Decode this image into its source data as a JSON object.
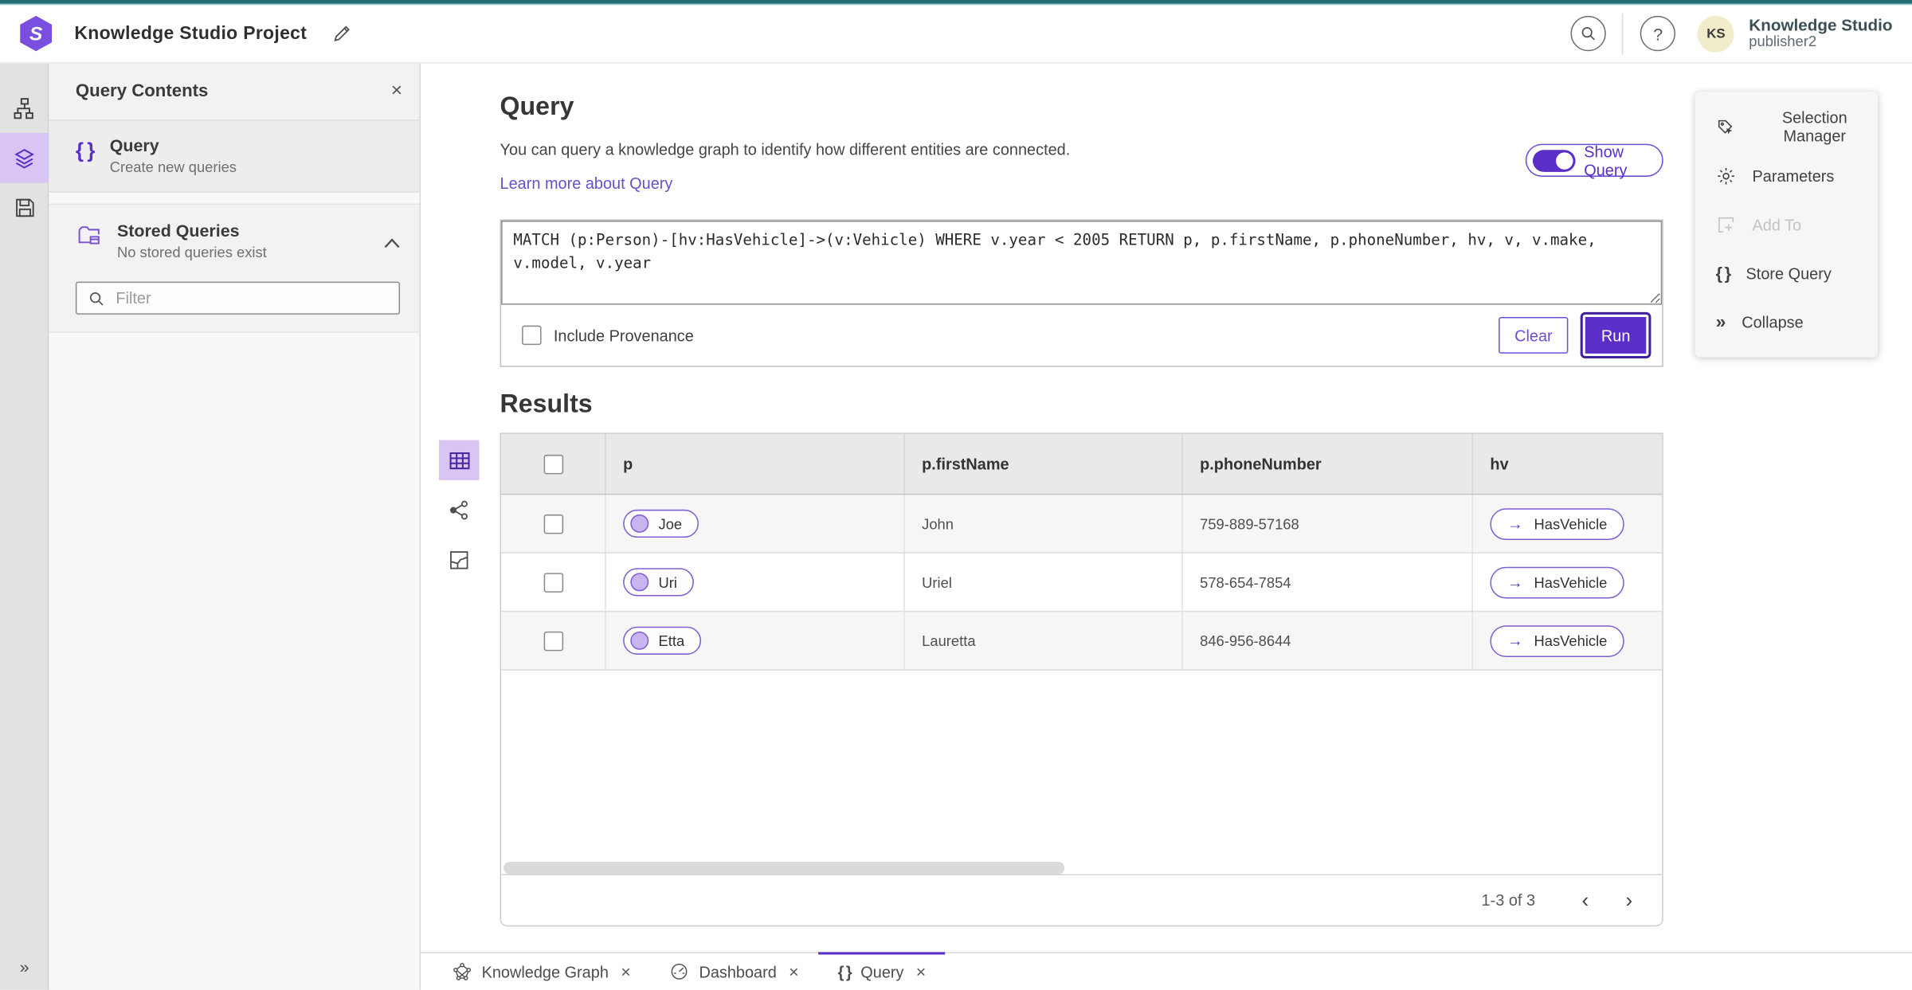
{
  "colors": {
    "accent": "#5b2ec8",
    "accent_border": "#6e4fd4",
    "accent_light": "#d8c5f4",
    "link": "#6352c8",
    "teal_top": "#256d74"
  },
  "icons": {
    "braces": "{ }",
    "close": "×",
    "question": "?",
    "chevron_left": "‹",
    "chevron_right": "›",
    "arrow_right": "→",
    "expand": "»"
  },
  "header": {
    "title": "Knowledge Studio Project",
    "product": "Knowledge Studio",
    "user": "publisher2",
    "avatar_initials": "KS"
  },
  "sidebar": {
    "title": "Query Contents",
    "query_item": {
      "label": "Query",
      "sublabel": "Create new queries"
    },
    "stored_item": {
      "label": "Stored Queries",
      "sublabel": "No stored queries exist"
    },
    "filter_placeholder": "Filter"
  },
  "query": {
    "title": "Query",
    "description": "You can query a knowledge graph to identify how different entities are connected.",
    "learn_more": "Learn more about Query",
    "show_query_label": "Show Query",
    "show_query_on": true,
    "query_text": "MATCH (p:Person)-[hv:HasVehicle]->(v:Vehicle) WHERE v.year < 2005 RETURN p, p.firstName, p.phoneNumber, hv, v, v.make, v.model, v.year",
    "include_provenance_label": "Include Provenance",
    "clear_label": "Clear",
    "run_label": "Run"
  },
  "results": {
    "title": "Results",
    "columns": [
      "p",
      "p.firstName",
      "p.phoneNumber",
      "hv"
    ],
    "rows": [
      {
        "p": "Joe",
        "firstName": "John",
        "phoneNumber": "759-889-57168",
        "hv": "HasVehicle"
      },
      {
        "p": "Uri",
        "firstName": "Uriel",
        "phoneNumber": "578-654-7854",
        "hv": "HasVehicle"
      },
      {
        "p": "Etta",
        "firstName": "Lauretta",
        "phoneNumber": "846-956-8644",
        "hv": "HasVehicle"
      }
    ],
    "pagination": "1-3 of 3"
  },
  "side_menu": {
    "items": [
      {
        "label": "Selection Manager",
        "disabled": false
      },
      {
        "label": "Parameters",
        "disabled": false
      },
      {
        "label": "Add To",
        "disabled": true
      },
      {
        "label": "Store Query",
        "disabled": false
      },
      {
        "label": "Collapse",
        "disabled": false
      }
    ]
  },
  "tabs": [
    {
      "label": "Knowledge Graph",
      "active": false
    },
    {
      "label": "Dashboard",
      "active": false
    },
    {
      "label": "Query",
      "active": true
    }
  ]
}
